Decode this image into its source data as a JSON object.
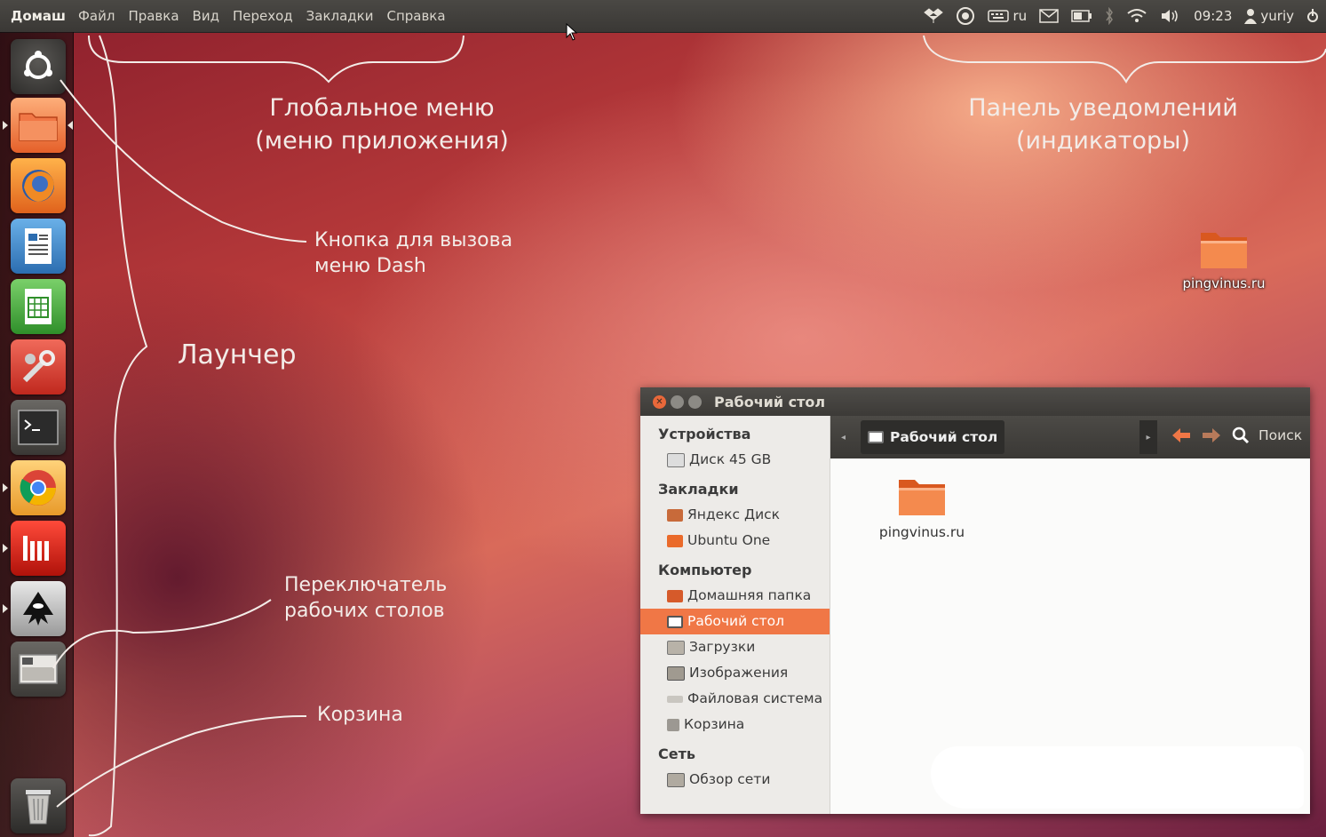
{
  "top_panel": {
    "app_title": "Домаш",
    "menu": [
      "Файл",
      "Правка",
      "Вид",
      "Переход",
      "Закладки",
      "Справка"
    ],
    "keyboard_layout": "ru",
    "time": "09:23",
    "user": "yuriy"
  },
  "annotations": {
    "global_menu": "Глобальное меню",
    "global_menu_sub": "(меню приложения)",
    "notif_panel": "Панель уведомлений",
    "notif_panel_sub": "(индикаторы)",
    "dash_button_1": "Кнопка для вызова",
    "dash_button_2": "меню Dash",
    "launcher": "Лаунчер",
    "switcher_1": "Переключатель",
    "switcher_2": "рабочих столов",
    "trash": "Корзина"
  },
  "launcher": {
    "items": [
      "dash-button",
      "files",
      "firefox",
      "writer",
      "calc",
      "settings",
      "terminal",
      "chrome",
      "indicator-app",
      "inkscape",
      "workspace-switcher",
      "trash"
    ]
  },
  "desktop": {
    "icon_label": "pingvinus.ru"
  },
  "window": {
    "title": "Рабочий стол",
    "breadcrumb": "Рабочий стол",
    "search_label": "Поиск",
    "sidebar": [
      {
        "section": "Устройства",
        "items": [
          "Диск 45 GB"
        ]
      },
      {
        "section": "Закладки",
        "items": [
          "Яндекс Диск",
          "Ubuntu One"
        ]
      },
      {
        "section": "Компьютер",
        "items": [
          "Домашняя папка",
          "Рабочий стол",
          "Загрузки",
          "Изображения",
          "Файловая система",
          "Корзина"
        ]
      },
      {
        "section": "Сеть",
        "items": [
          "Обзор сети"
        ]
      }
    ],
    "active_item": "Рабочий стол",
    "file_label": "pingvinus.ru"
  },
  "colors": {
    "accent": "#f07746",
    "panel": "#3c3b37"
  }
}
